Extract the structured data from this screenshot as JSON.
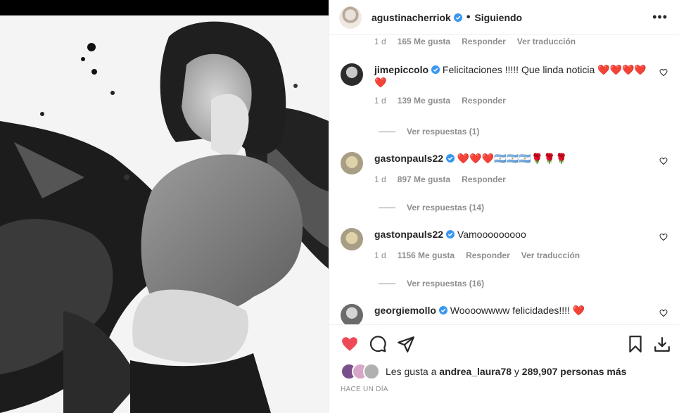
{
  "header": {
    "username": "agustinacherriok",
    "separator": "•",
    "follow_status": "Siguiendo",
    "more_icon": "more-icon"
  },
  "comments": [
    {
      "partial": true,
      "time": "1 d",
      "likes": "165 Me gusta",
      "reply": "Responder",
      "translate": "Ver traducción"
    },
    {
      "username": "jimepiccolo",
      "text": "Felicitaciones !!!!! Que linda noticia ❤️❤️❤️❤️❤️",
      "time": "1 d",
      "likes": "139 Me gusta",
      "reply": "Responder",
      "view_replies": "Ver respuestas (1)"
    },
    {
      "username": "gastonpauls22",
      "text": "❤️❤️❤️🇦🇷🇦🇷🇦🇷🌹🌹🌹",
      "time": "1 d",
      "likes": "897 Me gusta",
      "reply": "Responder",
      "view_replies": "Ver respuestas (14)"
    },
    {
      "username": "gastonpauls22",
      "text": "Vamooooooooo",
      "time": "1 d",
      "likes": "1156 Me gusta",
      "reply": "Responder",
      "translate": "Ver traducción",
      "view_replies": "Ver respuestas (16)"
    },
    {
      "username": "georgiemollo",
      "text": "Woooowwww felicidades!!!! ❤️"
    }
  ],
  "likes_summary": {
    "prefix": "Les gusta a",
    "user": "andrea_laura78",
    "joiner": "y",
    "count": "289,907 personas más"
  },
  "posted": "HACE UN DÍA",
  "colors": {
    "like": "#ed4956",
    "verified": "#3897f0",
    "muted": "#8e8e8e"
  }
}
